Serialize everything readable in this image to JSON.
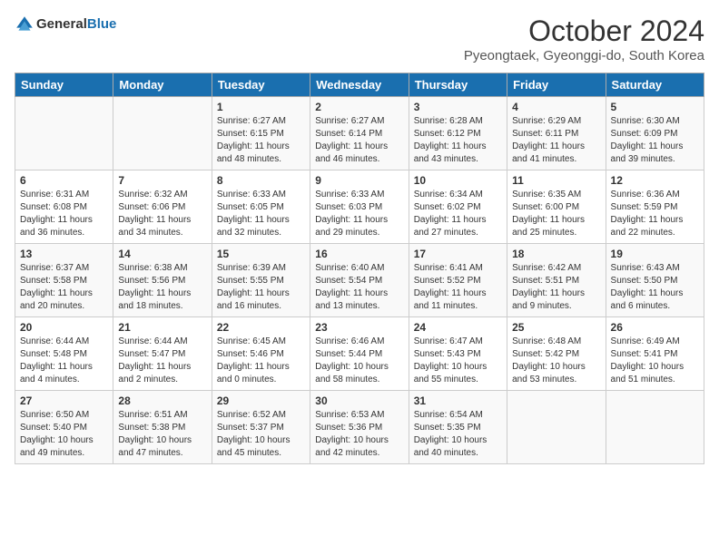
{
  "header": {
    "logo_general": "General",
    "logo_blue": "Blue",
    "month_year": "October 2024",
    "location": "Pyeongtaek, Gyeonggi-do, South Korea"
  },
  "weekdays": [
    "Sunday",
    "Monday",
    "Tuesday",
    "Wednesday",
    "Thursday",
    "Friday",
    "Saturday"
  ],
  "weeks": [
    [
      {
        "day": "",
        "info": ""
      },
      {
        "day": "",
        "info": ""
      },
      {
        "day": "1",
        "info": "Sunrise: 6:27 AM\nSunset: 6:15 PM\nDaylight: 11 hours\nand 48 minutes."
      },
      {
        "day": "2",
        "info": "Sunrise: 6:27 AM\nSunset: 6:14 PM\nDaylight: 11 hours\nand 46 minutes."
      },
      {
        "day": "3",
        "info": "Sunrise: 6:28 AM\nSunset: 6:12 PM\nDaylight: 11 hours\nand 43 minutes."
      },
      {
        "day": "4",
        "info": "Sunrise: 6:29 AM\nSunset: 6:11 PM\nDaylight: 11 hours\nand 41 minutes."
      },
      {
        "day": "5",
        "info": "Sunrise: 6:30 AM\nSunset: 6:09 PM\nDaylight: 11 hours\nand 39 minutes."
      }
    ],
    [
      {
        "day": "6",
        "info": "Sunrise: 6:31 AM\nSunset: 6:08 PM\nDaylight: 11 hours\nand 36 minutes."
      },
      {
        "day": "7",
        "info": "Sunrise: 6:32 AM\nSunset: 6:06 PM\nDaylight: 11 hours\nand 34 minutes."
      },
      {
        "day": "8",
        "info": "Sunrise: 6:33 AM\nSunset: 6:05 PM\nDaylight: 11 hours\nand 32 minutes."
      },
      {
        "day": "9",
        "info": "Sunrise: 6:33 AM\nSunset: 6:03 PM\nDaylight: 11 hours\nand 29 minutes."
      },
      {
        "day": "10",
        "info": "Sunrise: 6:34 AM\nSunset: 6:02 PM\nDaylight: 11 hours\nand 27 minutes."
      },
      {
        "day": "11",
        "info": "Sunrise: 6:35 AM\nSunset: 6:00 PM\nDaylight: 11 hours\nand 25 minutes."
      },
      {
        "day": "12",
        "info": "Sunrise: 6:36 AM\nSunset: 5:59 PM\nDaylight: 11 hours\nand 22 minutes."
      }
    ],
    [
      {
        "day": "13",
        "info": "Sunrise: 6:37 AM\nSunset: 5:58 PM\nDaylight: 11 hours\nand 20 minutes."
      },
      {
        "day": "14",
        "info": "Sunrise: 6:38 AM\nSunset: 5:56 PM\nDaylight: 11 hours\nand 18 minutes."
      },
      {
        "day": "15",
        "info": "Sunrise: 6:39 AM\nSunset: 5:55 PM\nDaylight: 11 hours\nand 16 minutes."
      },
      {
        "day": "16",
        "info": "Sunrise: 6:40 AM\nSunset: 5:54 PM\nDaylight: 11 hours\nand 13 minutes."
      },
      {
        "day": "17",
        "info": "Sunrise: 6:41 AM\nSunset: 5:52 PM\nDaylight: 11 hours\nand 11 minutes."
      },
      {
        "day": "18",
        "info": "Sunrise: 6:42 AM\nSunset: 5:51 PM\nDaylight: 11 hours\nand 9 minutes."
      },
      {
        "day": "19",
        "info": "Sunrise: 6:43 AM\nSunset: 5:50 PM\nDaylight: 11 hours\nand 6 minutes."
      }
    ],
    [
      {
        "day": "20",
        "info": "Sunrise: 6:44 AM\nSunset: 5:48 PM\nDaylight: 11 hours\nand 4 minutes."
      },
      {
        "day": "21",
        "info": "Sunrise: 6:44 AM\nSunset: 5:47 PM\nDaylight: 11 hours\nand 2 minutes."
      },
      {
        "day": "22",
        "info": "Sunrise: 6:45 AM\nSunset: 5:46 PM\nDaylight: 11 hours\nand 0 minutes."
      },
      {
        "day": "23",
        "info": "Sunrise: 6:46 AM\nSunset: 5:44 PM\nDaylight: 10 hours\nand 58 minutes."
      },
      {
        "day": "24",
        "info": "Sunrise: 6:47 AM\nSunset: 5:43 PM\nDaylight: 10 hours\nand 55 minutes."
      },
      {
        "day": "25",
        "info": "Sunrise: 6:48 AM\nSunset: 5:42 PM\nDaylight: 10 hours\nand 53 minutes."
      },
      {
        "day": "26",
        "info": "Sunrise: 6:49 AM\nSunset: 5:41 PM\nDaylight: 10 hours\nand 51 minutes."
      }
    ],
    [
      {
        "day": "27",
        "info": "Sunrise: 6:50 AM\nSunset: 5:40 PM\nDaylight: 10 hours\nand 49 minutes."
      },
      {
        "day": "28",
        "info": "Sunrise: 6:51 AM\nSunset: 5:38 PM\nDaylight: 10 hours\nand 47 minutes."
      },
      {
        "day": "29",
        "info": "Sunrise: 6:52 AM\nSunset: 5:37 PM\nDaylight: 10 hours\nand 45 minutes."
      },
      {
        "day": "30",
        "info": "Sunrise: 6:53 AM\nSunset: 5:36 PM\nDaylight: 10 hours\nand 42 minutes."
      },
      {
        "day": "31",
        "info": "Sunrise: 6:54 AM\nSunset: 5:35 PM\nDaylight: 10 hours\nand 40 minutes."
      },
      {
        "day": "",
        "info": ""
      },
      {
        "day": "",
        "info": ""
      }
    ]
  ]
}
